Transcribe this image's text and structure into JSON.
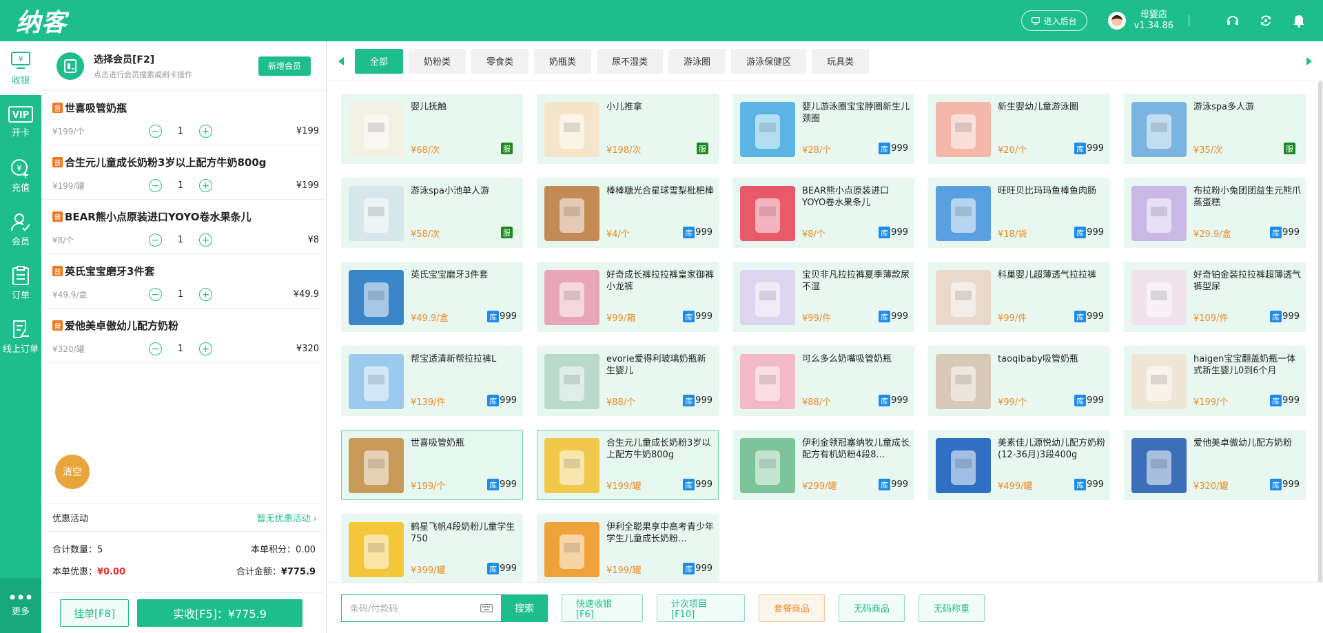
{
  "topbar": {
    "logo": "纳客",
    "backend_label": "进入后台",
    "shop_name": "母婴店",
    "version": "v1.34.86"
  },
  "nav": {
    "items": [
      {
        "label": "收银",
        "icon": "cashier-icon"
      },
      {
        "label": "开卡",
        "icon": "vip-card-icon"
      },
      {
        "label": "充值",
        "icon": "recharge-icon"
      },
      {
        "label": "会员",
        "icon": "member-icon"
      },
      {
        "label": "订单",
        "icon": "order-icon"
      },
      {
        "label": "线上订单",
        "icon": "online-order-icon"
      }
    ],
    "more_label": "更多"
  },
  "member": {
    "title": "选择会员[F2]",
    "hint": "点击进行会员搜索或刷卡操作",
    "new_member_label": "新增会员"
  },
  "cart": {
    "tag": "普",
    "items": [
      {
        "name": "世喜吸管奶瓶",
        "unit_price": "¥199/个",
        "qty": "1",
        "total": "¥199"
      },
      {
        "name": "合生元儿童成长奶粉3岁以上配方牛奶800g",
        "unit_price": "¥199/罐",
        "qty": "1",
        "total": "¥199"
      },
      {
        "name": "BEAR熊小点原装进口YOYO卷水果条儿",
        "unit_price": "¥8/个",
        "qty": "1",
        "total": "¥8"
      },
      {
        "name": "英氏宝宝磨牙3件套",
        "unit_price": "¥49.9/盒",
        "qty": "1",
        "total": "¥49.9"
      },
      {
        "name": "爱他美卓傲幼儿配方奶粉",
        "unit_price": "¥320/罐",
        "qty": "1",
        "total": "¥320"
      }
    ],
    "clear_label": "清空",
    "promo_label": "优惠活动",
    "promo_value": "暂无优惠活动",
    "total_qty_label": "合计数量：",
    "total_qty": "5",
    "points_label": "本单积分：",
    "points": "0.00",
    "discount_label": "本单优惠：",
    "discount": "¥0.00",
    "total_amount_label": "合计金额：",
    "total_amount": "¥775.9",
    "hold_label": "挂单[F8]",
    "pay_label": "实收[F5]：¥775.9"
  },
  "categories": [
    "全部",
    "奶粉类",
    "零食类",
    "奶瓶类",
    "尿不湿类",
    "游泳圈",
    "游泳保健区",
    "玩具类"
  ],
  "products": [
    {
      "name": "婴儿抚触",
      "price": "¥68/次",
      "badge": "服",
      "stock": "",
      "img_color": "#f3f0e4"
    },
    {
      "name": "小儿推拿",
      "price": "¥198/次",
      "badge": "服",
      "stock": "",
      "img_color": "#f6e6c9"
    },
    {
      "name": "婴儿游泳圈宝宝脖圈新生儿颈圈",
      "price": "¥28/个",
      "badge": "库",
      "stock": "999",
      "img_color": "#5bb3e6"
    },
    {
      "name": "新生婴幼儿童游泳圈",
      "price": "¥20/个",
      "badge": "库",
      "stock": "999",
      "img_color": "#f4b7a8"
    },
    {
      "name": "游泳spa多人游",
      "price": "¥35/次",
      "badge": "服",
      "stock": "",
      "img_color": "#7ab4e0"
    },
    {
      "name": "游泳spa小池单人游",
      "price": "¥58/次",
      "badge": "服",
      "stock": "",
      "img_color": "#d7e6ea"
    },
    {
      "name": "棒棒糖光合星球雪梨枇杷棒",
      "price": "¥4/个",
      "badge": "库",
      "stock": "999",
      "img_color": "#c48a55"
    },
    {
      "name": "BEAR熊小点原装进口YOYO卷水果条儿",
      "price": "¥8/个",
      "badge": "库",
      "stock": "999",
      "img_color": "#e85a6a"
    },
    {
      "name": "旺旺贝比玛玛鱼棒鱼肉肠",
      "price": "¥18/袋",
      "badge": "库",
      "stock": "999",
      "img_color": "#5aa0e0"
    },
    {
      "name": "布拉粉小兔团团益生元熊爪蒸蛋糕",
      "price": "¥29.9/盒",
      "badge": "库",
      "stock": "999",
      "img_color": "#c9b8e6"
    },
    {
      "name": "英氏宝宝磨牙3件套",
      "price": "¥49.9/盒",
      "badge": "库",
      "stock": "999",
      "img_color": "#3a86c8"
    },
    {
      "name": "好奇成长裤拉拉裤皇家御裤小龙裤",
      "price": "¥99/箱",
      "badge": "库",
      "stock": "999",
      "img_color": "#e8a6b8"
    },
    {
      "name": "宝贝非凡拉拉裤夏季薄款尿不湿",
      "price": "¥99/件",
      "badge": "库",
      "stock": "999",
      "img_color": "#ddd6ee"
    },
    {
      "name": "科巢婴儿超薄透气拉拉裤",
      "price": "¥99/件",
      "badge": "库",
      "stock": "999",
      "img_color": "#e9d8cc"
    },
    {
      "name": "好奇铂金装拉拉裤超薄透气裤型尿",
      "price": "¥109/件",
      "badge": "库",
      "stock": "999",
      "img_color": "#f0e3ec"
    },
    {
      "name": "帮宝适清新帮拉拉裤L",
      "price": "¥139/件",
      "badge": "库",
      "stock": "999",
      "img_color": "#9cc9ee"
    },
    {
      "name": "evorie爱得利玻璃奶瓶新生婴儿",
      "price": "¥88/个",
      "badge": "库",
      "stock": "999",
      "img_color": "#b9d9cc"
    },
    {
      "name": "可么多么奶嘴吸管奶瓶",
      "price": "¥88/个",
      "badge": "库",
      "stock": "999",
      "img_color": "#f5b8c6"
    },
    {
      "name": "taoqibaby吸管奶瓶",
      "price": "¥99/个",
      "badge": "库",
      "stock": "999",
      "img_color": "#d8c8b8"
    },
    {
      "name": "haigen宝宝翻盖奶瓶一体式新生婴儿0到6个月",
      "price": "¥199/个",
      "badge": "库",
      "stock": "999",
      "img_color": "#f0e6d6"
    },
    {
      "name": "世喜吸管奶瓶",
      "price": "¥199/个",
      "badge": "库",
      "stock": "999",
      "img_color": "#c89a5a",
      "selected": true
    },
    {
      "name": "合生元儿童成长奶粉3岁以上配方牛奶800g",
      "price": "¥199/罐",
      "badge": "库",
      "stock": "999",
      "img_color": "#f2c84b",
      "selected": true
    },
    {
      "name": "伊利金领冠塞纳牧儿童成长配方有机奶粉4段8...",
      "price": "¥299/罐",
      "badge": "库",
      "stock": "999",
      "img_color": "#7cc49a"
    },
    {
      "name": "美素佳儿源悦幼儿配方奶粉(12-36月)3段400g",
      "price": "¥499/罐",
      "badge": "库",
      "stock": "999",
      "img_color": "#2f6fc4"
    },
    {
      "name": "爱他美卓傲幼儿配方奶粉",
      "price": "¥320/罐",
      "badge": "库",
      "stock": "999",
      "img_color": "#3d6fb8"
    },
    {
      "name": "鹤星飞帆4段奶粉儿童学生750",
      "price": "¥399/罐",
      "badge": "库",
      "stock": "999",
      "img_color": "#f4c63a"
    },
    {
      "name": "伊利全聪果享中高考青少年学生儿童成长奶粉...",
      "price": "¥199/罐",
      "badge": "库",
      "stock": "999",
      "img_color": "#f0a23a"
    }
  ],
  "actions": {
    "barcode_placeholder": "条码/付款码",
    "search_label": "搜索",
    "quick_checkout": "快速收银[F6]",
    "count_items": "计次项目[F10]",
    "package_goods": "套餐商品",
    "no_code_goods": "无码商品",
    "no_code_weigh": "无码称重"
  },
  "colors": {
    "primary": "#1dbd8c",
    "price": "#f08a24",
    "stock_badge": "#1f8bec",
    "service_badge": "#198a1e",
    "discount": "#e8312f"
  }
}
